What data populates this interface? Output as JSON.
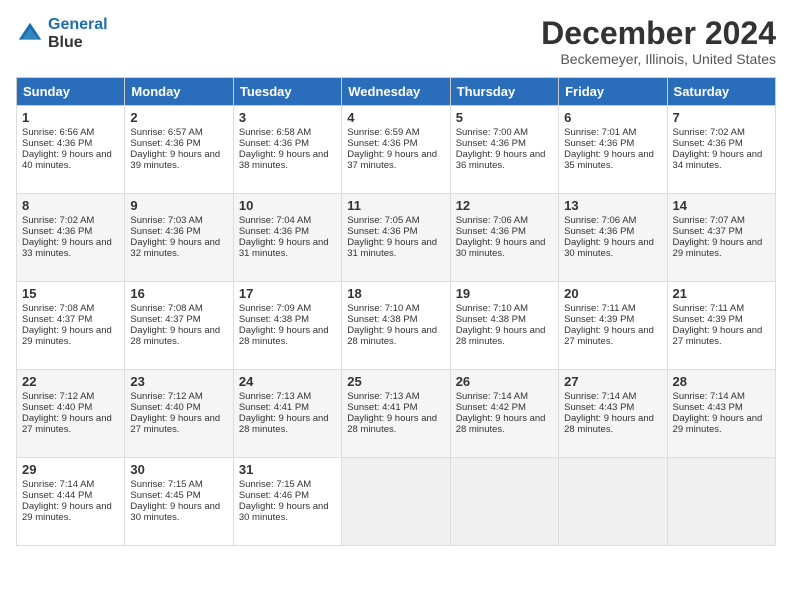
{
  "header": {
    "logo_line1": "General",
    "logo_line2": "Blue",
    "month": "December 2024",
    "location": "Beckemeyer, Illinois, United States"
  },
  "weekdays": [
    "Sunday",
    "Monday",
    "Tuesday",
    "Wednesday",
    "Thursday",
    "Friday",
    "Saturday"
  ],
  "weeks": [
    [
      {
        "day": "1",
        "info": "Sunrise: 6:56 AM\nSunset: 4:36 PM\nDaylight: 9 hours and 40 minutes."
      },
      {
        "day": "2",
        "info": "Sunrise: 6:57 AM\nSunset: 4:36 PM\nDaylight: 9 hours and 39 minutes."
      },
      {
        "day": "3",
        "info": "Sunrise: 6:58 AM\nSunset: 4:36 PM\nDaylight: 9 hours and 38 minutes."
      },
      {
        "day": "4",
        "info": "Sunrise: 6:59 AM\nSunset: 4:36 PM\nDaylight: 9 hours and 37 minutes."
      },
      {
        "day": "5",
        "info": "Sunrise: 7:00 AM\nSunset: 4:36 PM\nDaylight: 9 hours and 36 minutes."
      },
      {
        "day": "6",
        "info": "Sunrise: 7:01 AM\nSunset: 4:36 PM\nDaylight: 9 hours and 35 minutes."
      },
      {
        "day": "7",
        "info": "Sunrise: 7:02 AM\nSunset: 4:36 PM\nDaylight: 9 hours and 34 minutes."
      }
    ],
    [
      {
        "day": "8",
        "info": "Sunrise: 7:02 AM\nSunset: 4:36 PM\nDaylight: 9 hours and 33 minutes."
      },
      {
        "day": "9",
        "info": "Sunrise: 7:03 AM\nSunset: 4:36 PM\nDaylight: 9 hours and 32 minutes."
      },
      {
        "day": "10",
        "info": "Sunrise: 7:04 AM\nSunset: 4:36 PM\nDaylight: 9 hours and 31 minutes."
      },
      {
        "day": "11",
        "info": "Sunrise: 7:05 AM\nSunset: 4:36 PM\nDaylight: 9 hours and 31 minutes."
      },
      {
        "day": "12",
        "info": "Sunrise: 7:06 AM\nSunset: 4:36 PM\nDaylight: 9 hours and 30 minutes."
      },
      {
        "day": "13",
        "info": "Sunrise: 7:06 AM\nSunset: 4:36 PM\nDaylight: 9 hours and 30 minutes."
      },
      {
        "day": "14",
        "info": "Sunrise: 7:07 AM\nSunset: 4:37 PM\nDaylight: 9 hours and 29 minutes."
      }
    ],
    [
      {
        "day": "15",
        "info": "Sunrise: 7:08 AM\nSunset: 4:37 PM\nDaylight: 9 hours and 29 minutes."
      },
      {
        "day": "16",
        "info": "Sunrise: 7:08 AM\nSunset: 4:37 PM\nDaylight: 9 hours and 28 minutes."
      },
      {
        "day": "17",
        "info": "Sunrise: 7:09 AM\nSunset: 4:38 PM\nDaylight: 9 hours and 28 minutes."
      },
      {
        "day": "18",
        "info": "Sunrise: 7:10 AM\nSunset: 4:38 PM\nDaylight: 9 hours and 28 minutes."
      },
      {
        "day": "19",
        "info": "Sunrise: 7:10 AM\nSunset: 4:38 PM\nDaylight: 9 hours and 28 minutes."
      },
      {
        "day": "20",
        "info": "Sunrise: 7:11 AM\nSunset: 4:39 PM\nDaylight: 9 hours and 27 minutes."
      },
      {
        "day": "21",
        "info": "Sunrise: 7:11 AM\nSunset: 4:39 PM\nDaylight: 9 hours and 27 minutes."
      }
    ],
    [
      {
        "day": "22",
        "info": "Sunrise: 7:12 AM\nSunset: 4:40 PM\nDaylight: 9 hours and 27 minutes."
      },
      {
        "day": "23",
        "info": "Sunrise: 7:12 AM\nSunset: 4:40 PM\nDaylight: 9 hours and 27 minutes."
      },
      {
        "day": "24",
        "info": "Sunrise: 7:13 AM\nSunset: 4:41 PM\nDaylight: 9 hours and 28 minutes."
      },
      {
        "day": "25",
        "info": "Sunrise: 7:13 AM\nSunset: 4:41 PM\nDaylight: 9 hours and 28 minutes."
      },
      {
        "day": "26",
        "info": "Sunrise: 7:14 AM\nSunset: 4:42 PM\nDaylight: 9 hours and 28 minutes."
      },
      {
        "day": "27",
        "info": "Sunrise: 7:14 AM\nSunset: 4:43 PM\nDaylight: 9 hours and 28 minutes."
      },
      {
        "day": "28",
        "info": "Sunrise: 7:14 AM\nSunset: 4:43 PM\nDaylight: 9 hours and 29 minutes."
      }
    ],
    [
      {
        "day": "29",
        "info": "Sunrise: 7:14 AM\nSunset: 4:44 PM\nDaylight: 9 hours and 29 minutes."
      },
      {
        "day": "30",
        "info": "Sunrise: 7:15 AM\nSunset: 4:45 PM\nDaylight: 9 hours and 30 minutes."
      },
      {
        "day": "31",
        "info": "Sunrise: 7:15 AM\nSunset: 4:46 PM\nDaylight: 9 hours and 30 minutes."
      },
      null,
      null,
      null,
      null
    ]
  ]
}
